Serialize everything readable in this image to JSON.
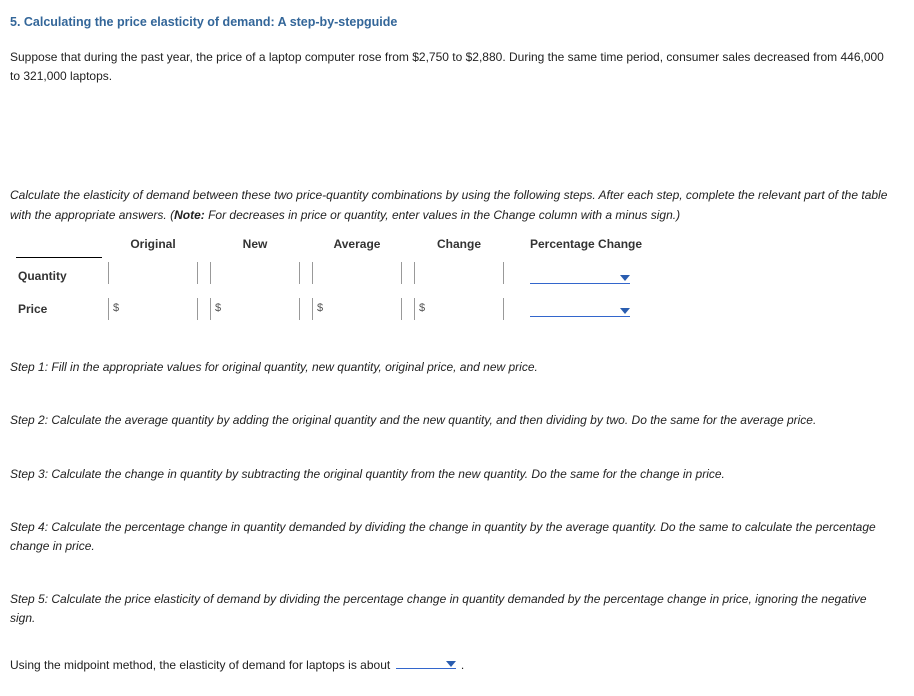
{
  "heading": "5. Calculating the price elasticity of demand: A step-by-stepguide",
  "intro1": "Suppose that during the past year, the price of a laptop computer rose from $2,750 to $2,880. During the same time period, consumer sales decreased from 446,000 to 321,000 laptops.",
  "instruct": "Calculate the elasticity of demand between these two price-quantity combinations by using the following steps. After each step, complete the relevant part of the table with the appropriate answers. (",
  "instruct_note_label": "Note:",
  "instruct_tail": " For decreases in price or quantity, enter values in the Change column with a minus sign.)",
  "headers": {
    "original": "Original",
    "new": "New",
    "average": "Average",
    "change": "Change",
    "pct": "Percentage Change"
  },
  "rows": {
    "quantity": "Quantity",
    "price": "Price"
  },
  "currency": "$",
  "step1": "Step 1: Fill in the appropriate values for original quantity, new quantity, original price, and new price.",
  "step2": "Step 2: Calculate the average quantity by adding the original quantity and the new quantity, and then dividing by two. Do the same for the average price.",
  "step3": "Step 3: Calculate the change in quantity by subtracting the original quantity from the new quantity. Do the same for the change in price.",
  "step4": "Step 4: Calculate the percentage change in quantity demanded by dividing the change in quantity by the average quantity. Do the same to calculate the percentage change in price.",
  "step5": "Step 5: Calculate the price elasticity of demand by dividing the percentage change in quantity demanded by the percentage change in price, ignoring the negative sign.",
  "final_pre": "Using the midpoint method, the elasticity of demand for laptops is about ",
  "final_post": " ."
}
